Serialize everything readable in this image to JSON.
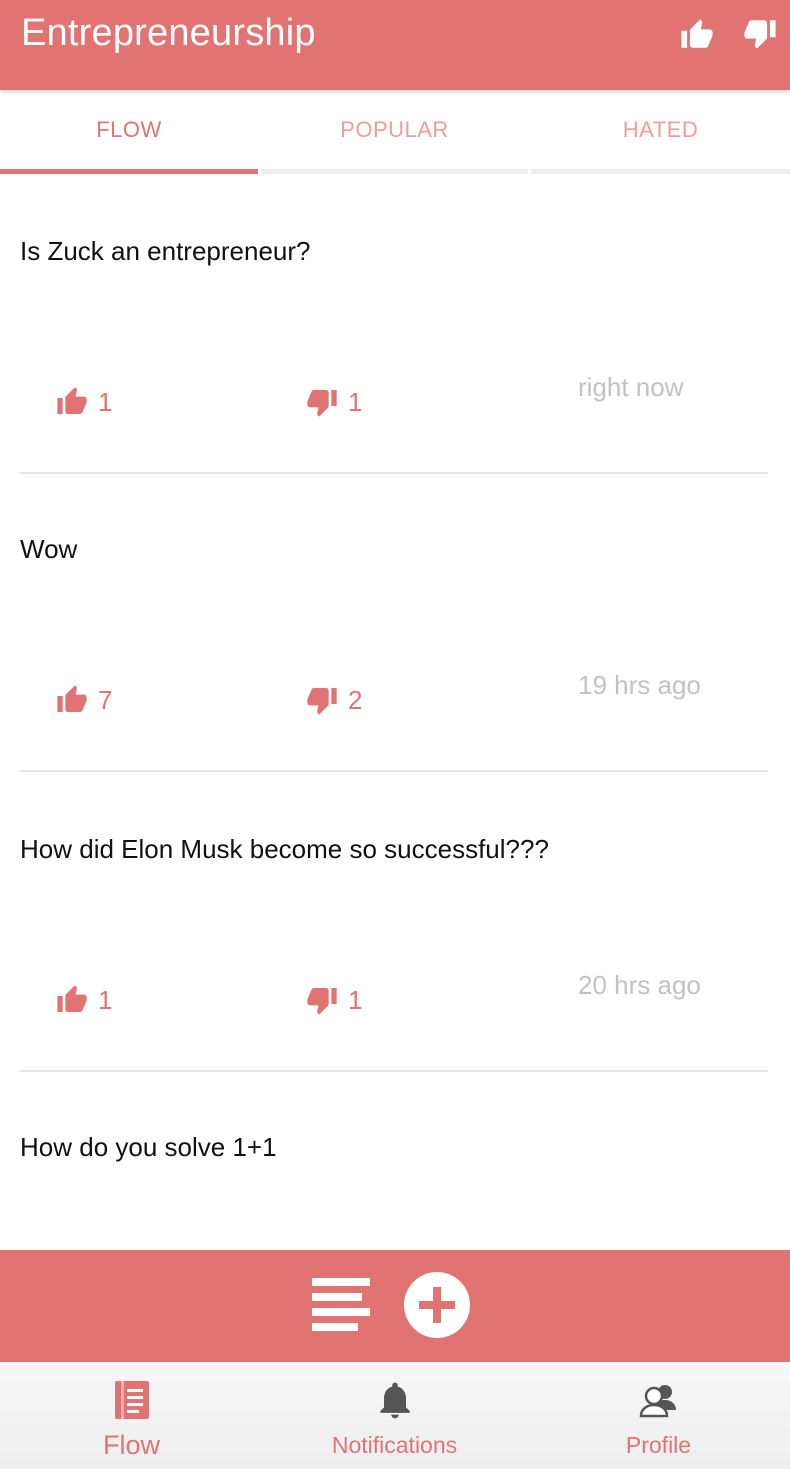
{
  "header": {
    "title": "Entrepreneurship",
    "like_icon": "thumbs-up-icon",
    "dislike_icon": "thumbs-down-icon"
  },
  "tabs": [
    {
      "label": "FLOW",
      "active": true
    },
    {
      "label": "POPULAR",
      "active": false
    },
    {
      "label": "HATED",
      "active": false
    }
  ],
  "posts": [
    {
      "question": "Is Zuck an entrepreneur?",
      "likes": "1",
      "dislikes": "1",
      "time": "right now"
    },
    {
      "question": "Wow",
      "likes": "7",
      "dislikes": "2",
      "time": "19 hrs ago"
    },
    {
      "question": "How did Elon Musk become so successful???",
      "likes": "1",
      "dislikes": "1",
      "time": "20 hrs ago"
    },
    {
      "question": "How do you solve 1+1",
      "likes": "",
      "dislikes": "",
      "time": ""
    }
  ],
  "actionbar": {
    "menu_icon": "list-icon",
    "add_icon": "plus-circle-icon"
  },
  "bottom_nav": [
    {
      "label": "Flow",
      "icon": "document-icon",
      "active": true
    },
    {
      "label": "Notifications",
      "icon": "bell-icon",
      "active": false
    },
    {
      "label": "Profile",
      "icon": "users-icon",
      "active": false
    }
  ],
  "colors": {
    "accent": "#e27373",
    "tab_inactive": "#ef9c9c",
    "muted_text": "#c2c2c2",
    "nav_icon": "#555555"
  }
}
